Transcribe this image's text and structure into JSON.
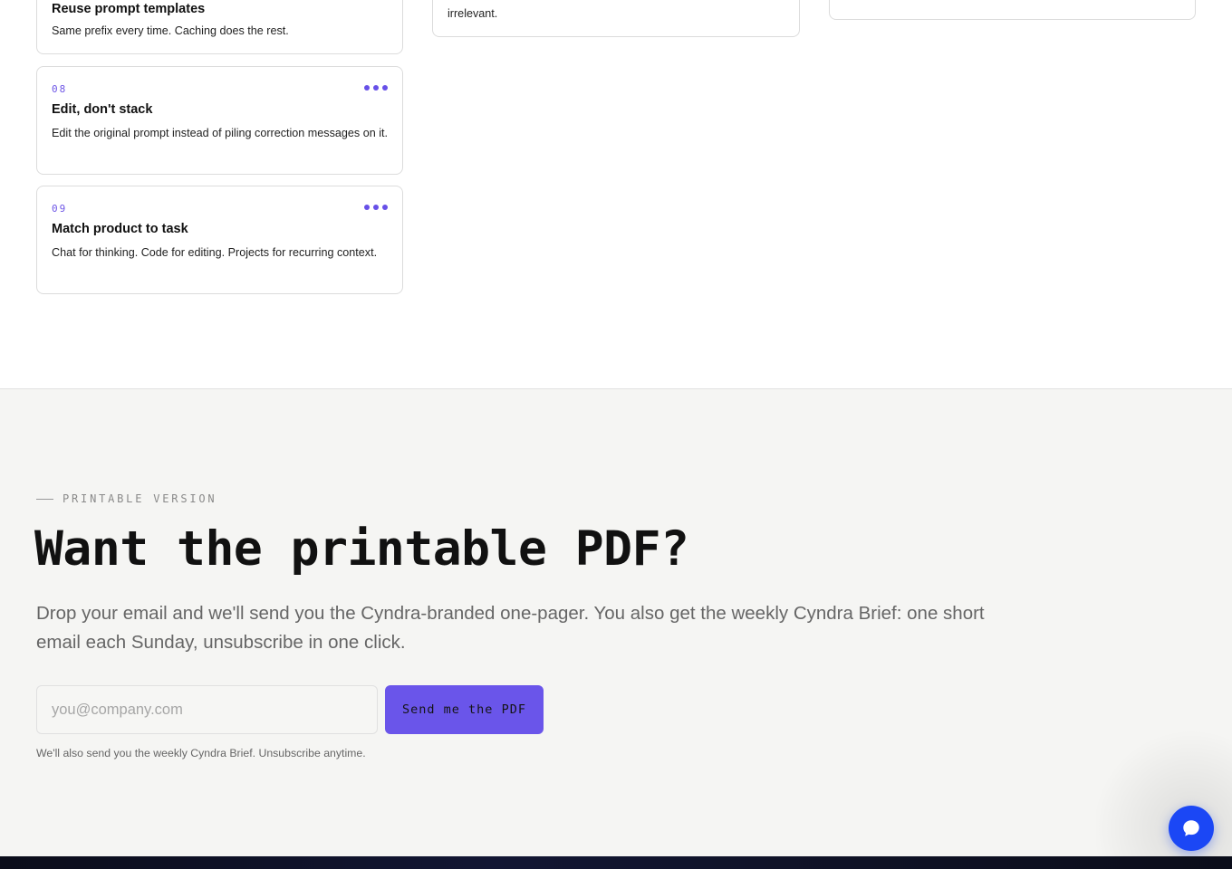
{
  "cards": {
    "c07": {
      "title": "Reuse prompt templates",
      "desc": "Same prefix every time. Caching does the rest."
    },
    "c08": {
      "num": "08",
      "title": "Edit, don't stack",
      "desc": "Edit the original prompt instead of piling correction messages on it."
    },
    "c09": {
      "num": "09",
      "title": "Match product to task",
      "desc": "Chat for thinking. Code for editing. Projects for recurring context."
    },
    "mid": {
      "desc_tail": "irrelevant."
    }
  },
  "cta": {
    "eyebrow": "PRINTABLE VERSION",
    "title": "Want the printable PDF?",
    "lead": "Drop your email and we'll send you the Cyndra-branded one-pager. You also get the weekly Cyndra Brief: one short email each Sunday, unsubscribe in one click.",
    "email_placeholder": "you@company.com",
    "email_value": "",
    "button": "Send me the PDF",
    "fineprint": "We'll also send you the weekly Cyndra Brief. Unsubscribe anytime."
  },
  "icons": {
    "card_menu": "more-dots-icon",
    "chat": "chat-bubble-icon"
  },
  "colors": {
    "accent": "#6a55ea",
    "chat": "#1b47f5",
    "footer": "#0b0d1a"
  }
}
